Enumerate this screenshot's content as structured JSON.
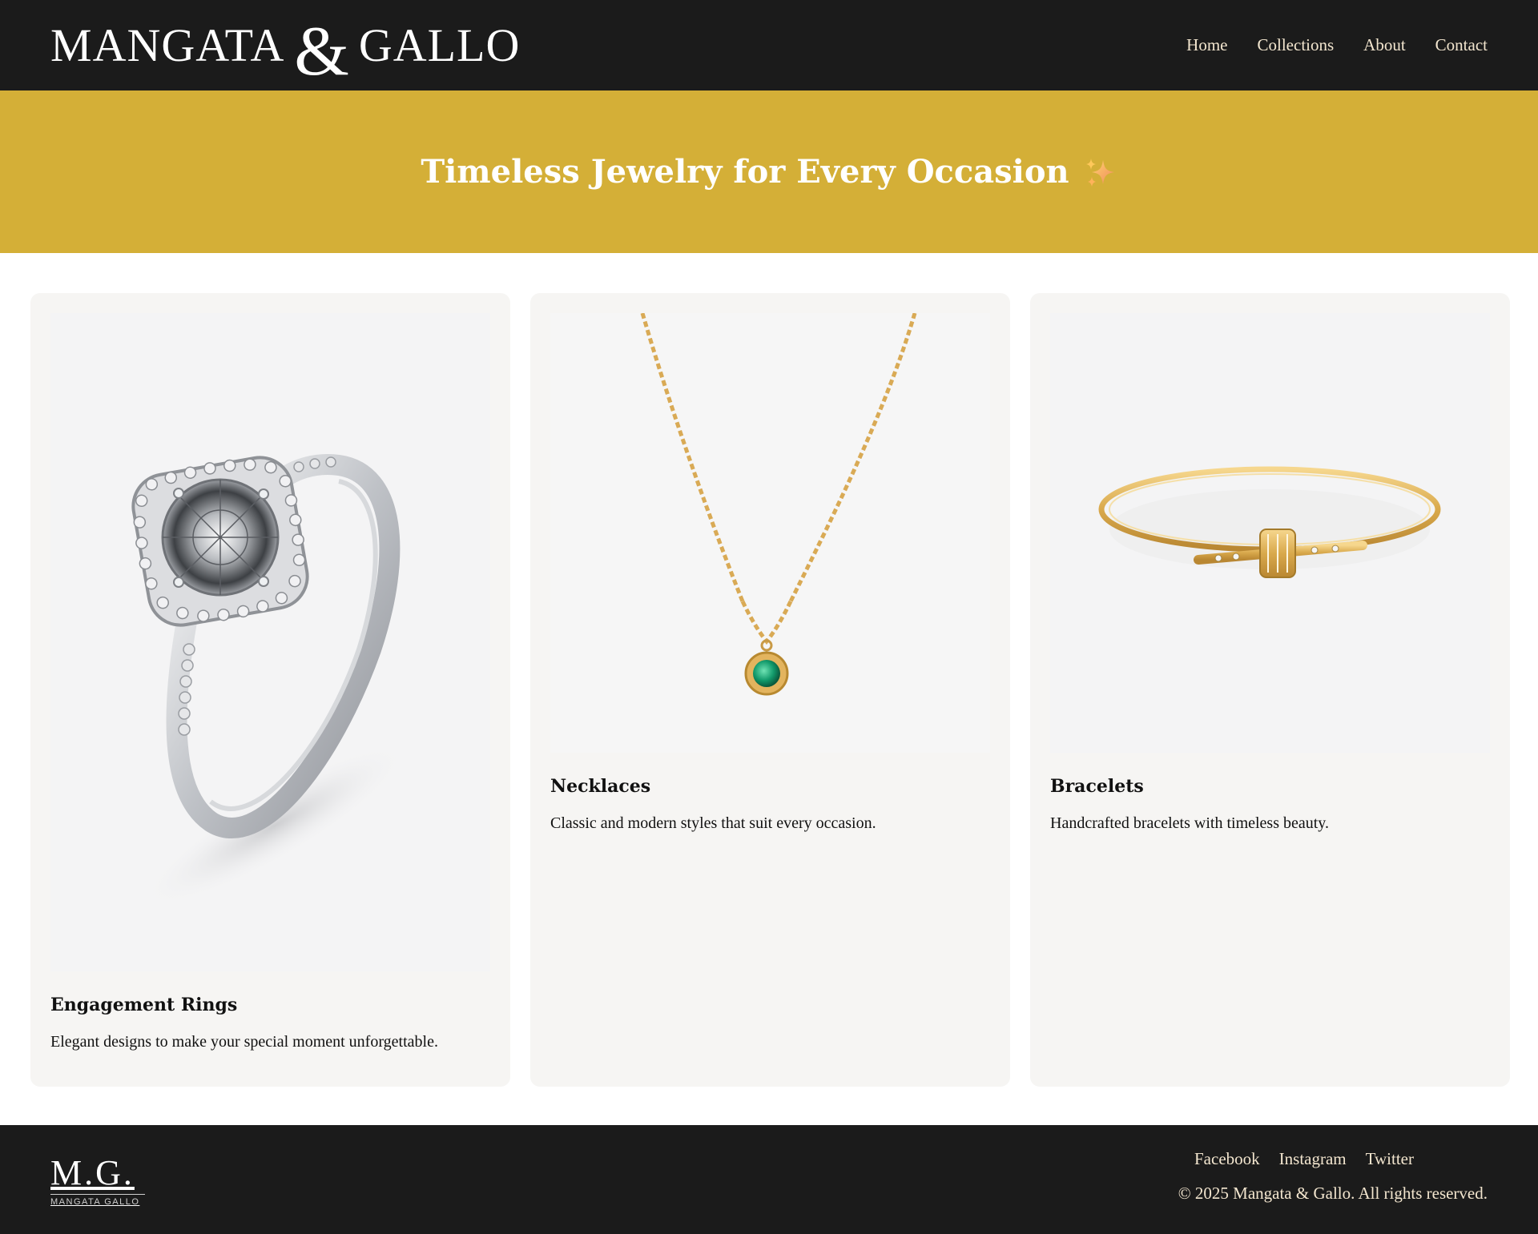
{
  "header": {
    "logo": {
      "word1": "MANGATA",
      "amp": "&",
      "word2": "GALLO"
    },
    "nav": [
      {
        "label": "Home"
      },
      {
        "label": "Collections"
      },
      {
        "label": "About"
      },
      {
        "label": "Contact"
      }
    ]
  },
  "hero": {
    "title": "Timeless Jewelry for Every Occasion",
    "icon": "sparkles-emoji"
  },
  "cards": [
    {
      "title": "Engagement Rings",
      "description": "Elegant designs to make your special moment unforgettable.",
      "image": "diamond-halo-ring"
    },
    {
      "title": "Necklaces",
      "description": "Classic and modern styles that suit every occasion.",
      "image": "gold-chain-emerald-pendant"
    },
    {
      "title": "Bracelets",
      "description": "Handcrafted bracelets with timeless beauty.",
      "image": "gold-cuff-bracelet"
    }
  ],
  "footer": {
    "logo": {
      "mark": "M.G.",
      "sub": "MANGATA GALLO"
    },
    "social": [
      {
        "label": "Facebook"
      },
      {
        "label": "Instagram"
      },
      {
        "label": "Twitter"
      }
    ],
    "copyright": "© 2025 Mangata & Gallo. All rights reserved."
  },
  "colors": {
    "header_bg": "#1b1b1b",
    "hero_bg": "#d4af37",
    "link": "#f3e6cf",
    "card_bg": "#f6f5f3"
  }
}
